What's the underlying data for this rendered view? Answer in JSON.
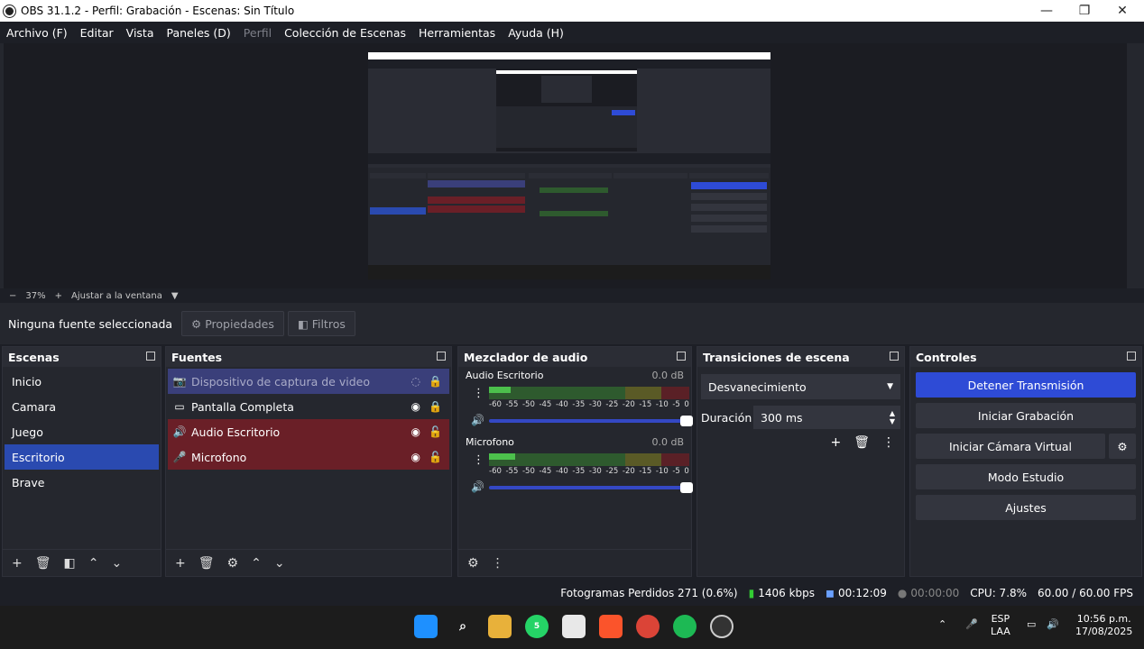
{
  "window": {
    "title": "OBS 31.1.2 - Perfil: Grabación - Escenas: Sin Título",
    "minimize_glyph": "—",
    "maximize_glyph": "❐",
    "close_glyph": "✕"
  },
  "menu": [
    "Archivo (F)",
    "Editar",
    "Vista",
    "Paneles (D)",
    "Perfil",
    "Colección de Escenas",
    "Herramientas",
    "Ayuda (H)"
  ],
  "zoom": {
    "minus": "−",
    "value": "37%",
    "plus": "+",
    "fit_label": "Ajustar a la ventana"
  },
  "source_toolbar": {
    "no_source": "Ninguna fuente seleccionada",
    "properties": "Propiedades",
    "filters": "Filtros"
  },
  "scenes": {
    "title": "Escenas",
    "items": [
      "Inicio",
      "Camara",
      "Juego",
      "Escritorio",
      "Brave"
    ],
    "selected": "Escritorio"
  },
  "sources": {
    "title": "Fuentes",
    "items": [
      {
        "label": "Dispositivo de captura de video",
        "icon": "camera-icon"
      },
      {
        "label": "Pantalla Completa",
        "icon": "monitor-icon"
      },
      {
        "label": "Audio Escritorio",
        "icon": "speaker-icon"
      },
      {
        "label": "Microfono",
        "icon": "microphone-icon"
      }
    ]
  },
  "mixer": {
    "title": "Mezclador de audio",
    "channels": [
      {
        "name": "Audio Escritorio",
        "db": "0.0 dB",
        "level": 0.11
      },
      {
        "name": "Microfono",
        "db": "0.0 dB",
        "level": 0.13
      }
    ],
    "scale": [
      "-60",
      "-55",
      "-50",
      "-45",
      "-40",
      "-35",
      "-30",
      "-25",
      "-20",
      "-15",
      "-10",
      "-5",
      "0"
    ]
  },
  "transitions": {
    "title": "Transiciones de escena",
    "selected": "Desvanecimiento",
    "duration_label": "Duración",
    "duration": "300 ms"
  },
  "controls": {
    "title": "Controles",
    "stop_stream": "Detener Transmisión",
    "start_recording": "Iniciar Grabación",
    "virtual_cam": "Iniciar Cámara Virtual",
    "studio_mode": "Modo Estudio",
    "settings": "Ajustes"
  },
  "status": {
    "dropped": "Fotogramas Perdidos 271 (0.6%)",
    "bitrate": "1406 kbps",
    "stream_time": "00:12:09",
    "rec_time": "00:00:00",
    "cpu": "CPU: 7.8%",
    "fps": "60.00 / 60.00 FPS"
  },
  "taskbar": {
    "lang": "ESP",
    "lang2": "LAA",
    "time": "10:56 p.m.",
    "date": "17/08/2025",
    "whatsapp_badge": "5"
  },
  "colors": {
    "accent": "#2e4bd6",
    "panel": "#25272e",
    "selected_scene": "#2a4ab0",
    "audio_source": "#6a1f27"
  }
}
